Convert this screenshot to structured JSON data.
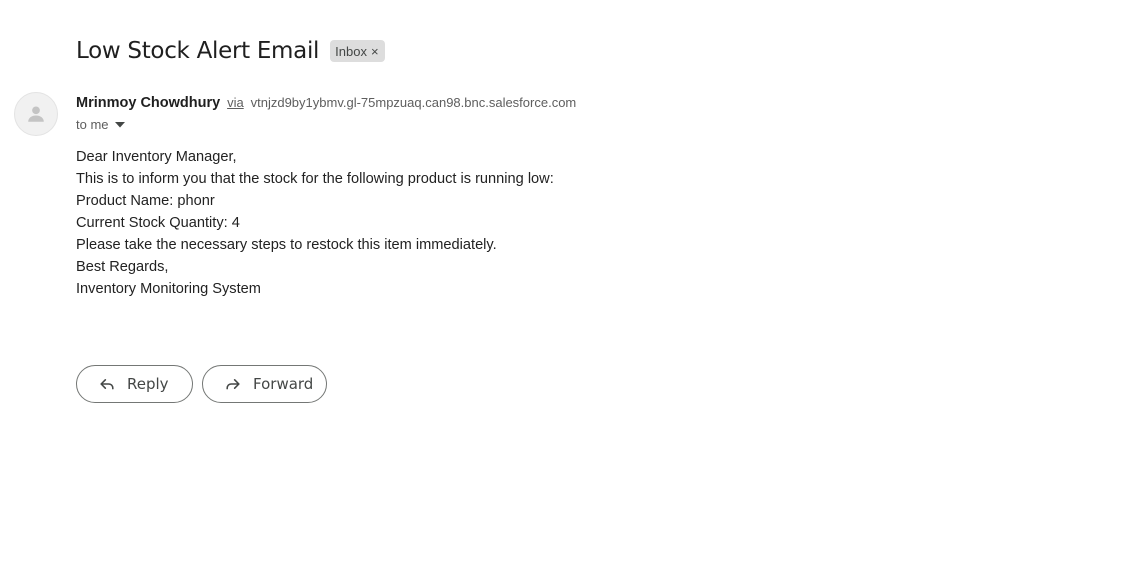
{
  "email": {
    "subject": "Low Stock Alert Email",
    "label": {
      "name": "Inbox",
      "remove_glyph": "×"
    },
    "sender": {
      "name": "Mrinmoy Chowdhury",
      "via_label": "via",
      "via_domain": "vtnjzd9by1ybmv.gl-75mpzuaq.can98.bnc.salesforce.com",
      "avatar_icon": "person-icon"
    },
    "recipient_text": "to me",
    "body_lines": [
      "Dear Inventory Manager,",
      "This is to inform you that the stock for the following product is running low:",
      "Product Name: phonr",
      "Current Stock Quantity: 4",
      "Please take the necessary steps to restock this item immediately.",
      "Best Regards,",
      "Inventory Monitoring System"
    ]
  },
  "actions": {
    "reply_label": "Reply",
    "reply_icon": "reply-icon",
    "forward_label": "Forward",
    "forward_icon": "forward-icon"
  },
  "colors": {
    "chip_background": "#dddddd",
    "muted_text": "#5e5e5e",
    "button_border": "#747775"
  }
}
